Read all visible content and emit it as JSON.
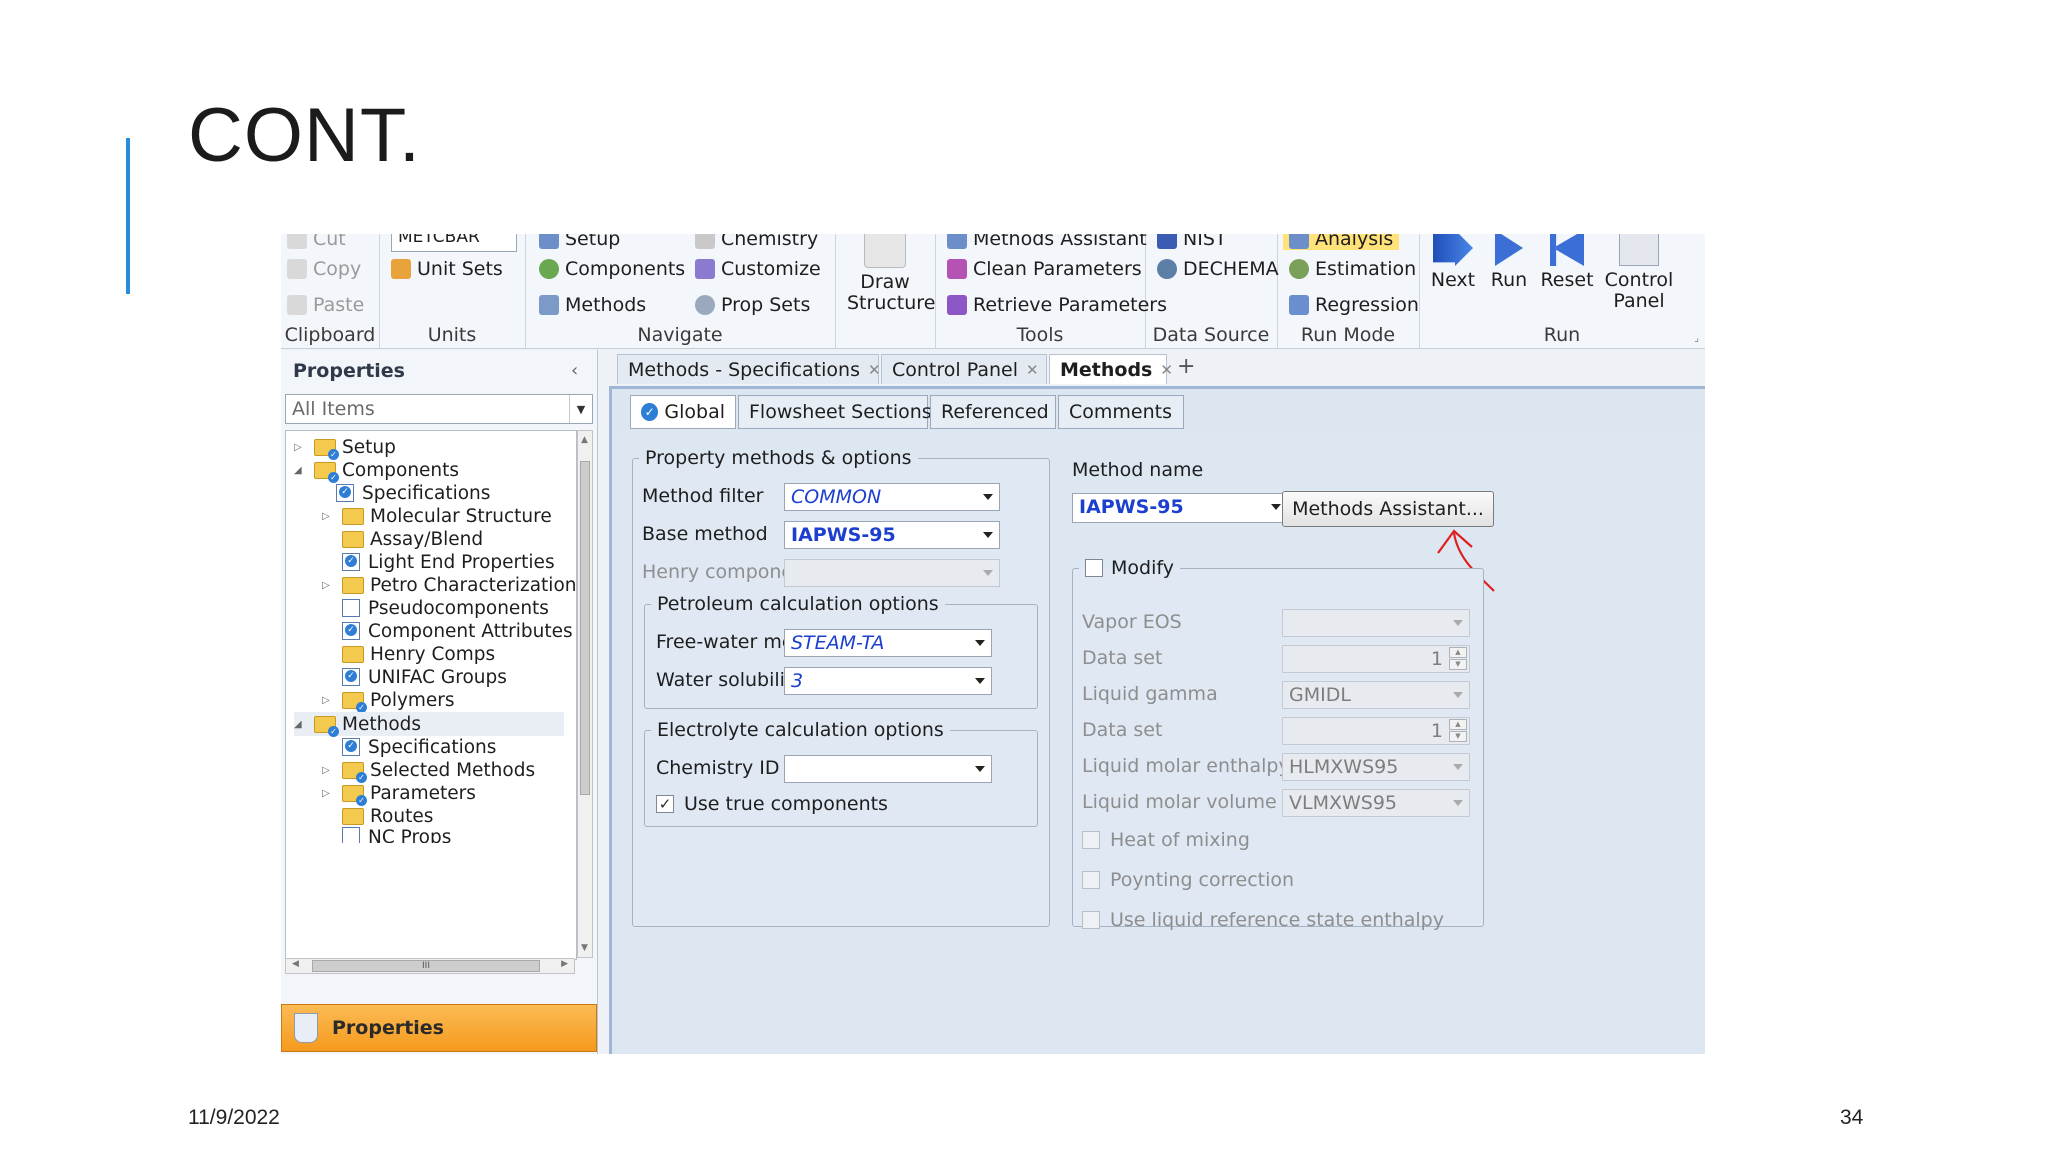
{
  "slide": {
    "title": "CONT.",
    "date": "11/9/2022",
    "page_number": "34"
  },
  "ribbon": {
    "clipboard": {
      "label": "Clipboard",
      "cut": "Cut",
      "copy": "Copy",
      "paste": "Paste"
    },
    "units": {
      "label": "Units",
      "units_set_value": "METCBAR",
      "unit_sets": "Unit Sets"
    },
    "navigate": {
      "label": "Navigate",
      "setup": "Setup",
      "components": "Components",
      "methods": "Methods",
      "chemistry": "Chemistry",
      "customize": "Customize",
      "prop_sets": "Prop Sets"
    },
    "draw_structure": {
      "line1": "Draw",
      "line2": "Structure"
    },
    "tools": {
      "label": "Tools",
      "methods_assistant": "Methods Assistant",
      "clean_parameters": "Clean Parameters",
      "retrieve_parameters": "Retrieve Parameters"
    },
    "data_source": {
      "label": "Data Source",
      "nist": "NIST",
      "dechema": "DECHEMA"
    },
    "run_mode": {
      "label": "Run Mode",
      "analysis": "Analysis",
      "estimation": "Estimation",
      "regression": "Regression"
    },
    "run": {
      "label": "Run",
      "next": "Next",
      "run": "Run",
      "reset": "Reset",
      "control_panel_1": "Control",
      "control_panel_2": "Panel"
    }
  },
  "navigation_pane": {
    "title": "Properties",
    "filter_value": "All Items",
    "tree": [
      {
        "label": "Setup"
      },
      {
        "label": "Components"
      },
      {
        "label": "Specifications"
      },
      {
        "label": "Molecular Structure"
      },
      {
        "label": "Assay/Blend"
      },
      {
        "label": "Light End Properties"
      },
      {
        "label": "Petro Characterization"
      },
      {
        "label": "Pseudocomponents"
      },
      {
        "label": "Component Attributes"
      },
      {
        "label": "Henry Comps"
      },
      {
        "label": "UNIFAC Groups"
      },
      {
        "label": "Polymers"
      },
      {
        "label": "Methods"
      },
      {
        "label": "Specifications"
      },
      {
        "label": "Selected Methods"
      },
      {
        "label": "Parameters"
      },
      {
        "label": "Routes"
      },
      {
        "label": "NC Props"
      }
    ],
    "hscroll_glyph": "III",
    "properties_button": "Properties"
  },
  "document_tabs": [
    {
      "label": "Methods - Specifications"
    },
    {
      "label": "Control Panel"
    },
    {
      "label": "Methods"
    }
  ],
  "form_tabs": [
    "Global",
    "Flowsheet Sections",
    "Referenced",
    "Comments"
  ],
  "property_methods": {
    "legend": "Property methods & options",
    "method_filter_label": "Method filter",
    "method_filter_value": "COMMON",
    "base_method_label": "Base method",
    "base_method_value": "IAPWS-95",
    "henry_label": "Henry components",
    "petroleum": {
      "legend": "Petroleum calculation options",
      "free_water_label": "Free-water method",
      "free_water_value": "STEAM-TA",
      "water_solubility_label": "Water solubility",
      "water_solubility_value": "3"
    },
    "electrolyte": {
      "legend": "Electrolyte calculation options",
      "chemistry_id_label": "Chemistry ID",
      "use_true_components_label": "Use true components"
    }
  },
  "method_name": {
    "label": "Method name",
    "value": "IAPWS-95",
    "assistant_button": "Methods Assistant..."
  },
  "modify": {
    "legend": "Modify",
    "vapor_eos_label": "Vapor EOS",
    "data_set_label": "Data set",
    "data_set_1": "1",
    "liquid_gamma_label": "Liquid gamma",
    "liquid_gamma_value": "GMIDL",
    "data_set_2": "1",
    "liquid_molar_enthalpy_label": "Liquid molar enthalpy",
    "liquid_molar_enthalpy_value": "HLMXWS95",
    "liquid_molar_volume_label": "Liquid molar volume",
    "liquid_molar_volume_value": "VLMXWS95",
    "heat_of_mixing_label": "Heat of mixing",
    "poynting_label": "Poynting correction",
    "liquid_ref_label": "Use liquid reference state enthalpy"
  }
}
